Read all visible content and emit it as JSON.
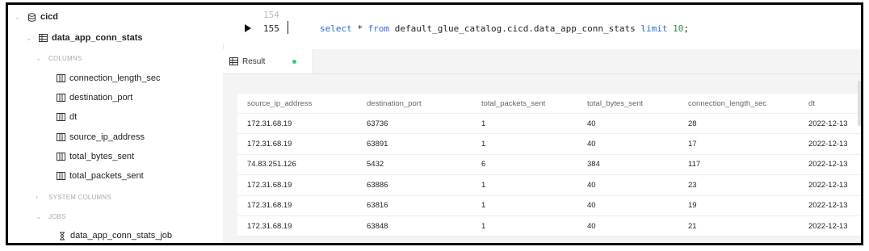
{
  "sidebar": {
    "catalog": "cicd",
    "table": "data_app_conn_stats",
    "columns_header": "COLUMNS",
    "columns": [
      "connection_length_sec",
      "destination_port",
      "dt",
      "source_ip_address",
      "total_bytes_sent",
      "total_packets_sent"
    ],
    "system_columns_header": "SYSTEM COLUMNS",
    "jobs_header": "JOBS",
    "jobs": [
      "data_app_conn_stats_job"
    ]
  },
  "editor": {
    "lines": [
      {
        "number": "154",
        "text": ""
      },
      {
        "number": "155",
        "select": "select",
        "star": " * ",
        "from": "from",
        "table": " default_glue_catalog.cicd.data_app_conn_stats ",
        "limit": "limit",
        "value": " 10",
        "end": ";"
      }
    ]
  },
  "tabs": [
    {
      "label": "Result",
      "status_color": "#2ecc71"
    }
  ],
  "result": {
    "headers": [
      "source_ip_address",
      "destination_port",
      "total_packets_sent",
      "total_bytes_sent",
      "connection_length_sec",
      "dt"
    ],
    "rows": [
      [
        "172.31.68.19",
        "63736",
        "1",
        "40",
        "28",
        "2022-12-13"
      ],
      [
        "172.31.68.19",
        "63891",
        "1",
        "40",
        "17",
        "2022-12-13"
      ],
      [
        "74.83.251.126",
        "5432",
        "6",
        "384",
        "117",
        "2022-12-13"
      ],
      [
        "172.31.68.19",
        "63886",
        "1",
        "40",
        "23",
        "2022-12-13"
      ],
      [
        "172.31.68.19",
        "63816",
        "1",
        "40",
        "19",
        "2022-12-13"
      ],
      [
        "172.31.68.19",
        "63848",
        "1",
        "40",
        "21",
        "2022-12-13"
      ]
    ]
  },
  "icons": {
    "database": "database-icon",
    "table": "table-icon",
    "column": "column-icon",
    "job": "job-icon",
    "run": "run-icon"
  }
}
